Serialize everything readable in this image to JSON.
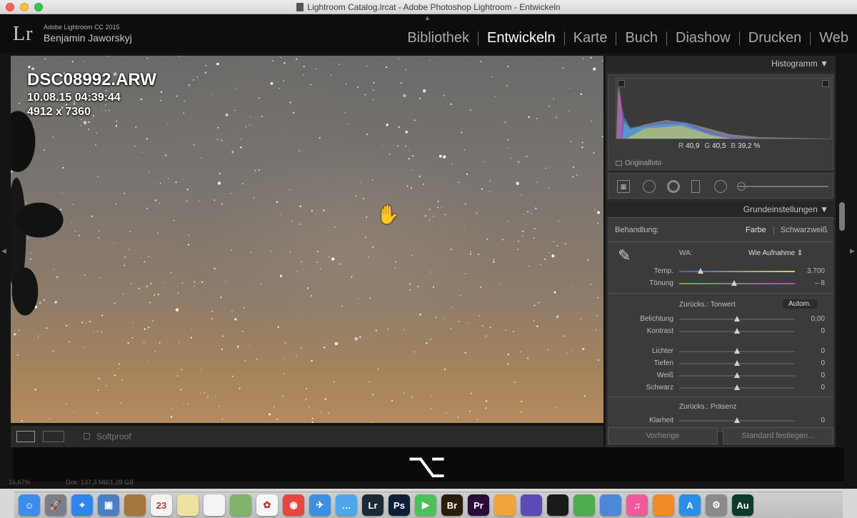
{
  "window": {
    "title": "Lightroom Catalog.lrcat - Adobe Photoshop Lightroom - Entwickeln"
  },
  "header": {
    "logo": "Lr",
    "product": "Adobe Lightroom CC 2015",
    "user": "Benjamin Jaworskyj",
    "modules": [
      "Bibliothek",
      "Entwickeln",
      "Karte",
      "Buch",
      "Diashow",
      "Drucken",
      "Web"
    ],
    "active_module": "Entwickeln"
  },
  "photo": {
    "filename": "DSC08992.ARW",
    "datetime": "10.08.15 04:39:44",
    "dimensions": "4912 x 7360"
  },
  "toolbar": {
    "softproof_label": "Softproof"
  },
  "histogram": {
    "title": "Histogramm",
    "r_label": "R",
    "r_value": "40,9",
    "g_label": "G",
    "g_value": "40,5",
    "b_label": "B",
    "b_value": "39,2 %",
    "original_label": "Originalfoto"
  },
  "basic": {
    "title": "Grundeinstellungen",
    "treatment_label": "Behandlung:",
    "treatment_color": "Farbe",
    "treatment_bw": "Schwarzweiß",
    "wb_label": "WA:",
    "wb_value": "Wie Aufnahme",
    "temp_label": "Temp.",
    "temp_value": "3.700",
    "tint_label": "Tönung",
    "tint_value": "– 8",
    "tone_reset": "Zurücks.: Tonwert",
    "auto_label": "Autom.",
    "exposure_label": "Belichtung",
    "exposure_value": "0,00",
    "contrast_label": "Kontrast",
    "contrast_value": "0",
    "highlights_label": "Lichter",
    "highlights_value": "0",
    "shadows_label": "Tiefen",
    "shadows_value": "0",
    "whites_label": "Weiß",
    "whites_value": "0",
    "blacks_label": "Schwarz",
    "blacks_value": "0",
    "presence_reset": "Zurücks.: Präsenz",
    "clarity_label": "Klarheit",
    "clarity_value": "0"
  },
  "buttons": {
    "previous": "Vorherige",
    "set_default": "Standard festlegen..."
  },
  "overlay": {
    "key_glyph": "⌥"
  },
  "status": {
    "zoom": "16,67%",
    "doc_info": "Dok: 137,3 MB/1,28 GB"
  },
  "dock": [
    {
      "icon": "finder-icon",
      "label": "☺",
      "color": "#3c8cf0"
    },
    {
      "icon": "launchpad-icon",
      "label": "🚀",
      "color": "#7a7f88"
    },
    {
      "icon": "safari-icon",
      "label": "⌖",
      "color": "#2f86e8"
    },
    {
      "icon": "preview-icon",
      "label": "▣",
      "color": "#4a7fc4"
    },
    {
      "icon": "notes-brown-icon",
      "label": "",
      "color": "#a5753e"
    },
    {
      "icon": "calendar-icon",
      "label": "23",
      "color": "#f3f3f3"
    },
    {
      "icon": "stickies-icon",
      "label": "",
      "color": "#efe2a0"
    },
    {
      "icon": "reminders-icon",
      "label": "",
      "color": "#f4f4f4"
    },
    {
      "icon": "maps-icon",
      "label": "",
      "color": "#7fb46a"
    },
    {
      "icon": "photos-icon",
      "label": "✿",
      "color": "#f7f7f7"
    },
    {
      "icon": "chrome-icon",
      "label": "◉",
      "color": "#e8453c"
    },
    {
      "icon": "mail-icon",
      "label": "✈",
      "color": "#3d8fe0"
    },
    {
      "icon": "messages-icon",
      "label": "…",
      "color": "#4ea7ea"
    },
    {
      "icon": "lightroom-icon",
      "label": "Lr",
      "color": "#1b2a35"
    },
    {
      "icon": "photoshop-icon",
      "label": "Ps",
      "color": "#0e1f38"
    },
    {
      "icon": "facetime-icon",
      "label": "▶",
      "color": "#4cc15a"
    },
    {
      "icon": "bridge-icon",
      "label": "Br",
      "color": "#2b1d0b"
    },
    {
      "icon": "premiere-icon",
      "label": "Pr",
      "color": "#2a0b3a"
    },
    {
      "icon": "pages-icon",
      "label": "",
      "color": "#f0a43b"
    },
    {
      "icon": "imovie-icon",
      "label": "",
      "color": "#5a4bb5"
    },
    {
      "icon": "fcp-icon",
      "label": "",
      "color": "#1a1a1a"
    },
    {
      "icon": "numbers-icon",
      "label": "",
      "color": "#4cae4c"
    },
    {
      "icon": "keynote-icon",
      "label": "",
      "color": "#4d87d6"
    },
    {
      "icon": "itunes-icon",
      "label": "♫",
      "color": "#f05a9c"
    },
    {
      "icon": "ibooks-icon",
      "label": "",
      "color": "#f08a24"
    },
    {
      "icon": "appstore-icon",
      "label": "A",
      "color": "#2a8de6"
    },
    {
      "icon": "system-prefs-icon",
      "label": "⚙",
      "color": "#8a8a8a"
    },
    {
      "icon": "audition-icon",
      "label": "Au",
      "color": "#0c3a2d"
    }
  ]
}
